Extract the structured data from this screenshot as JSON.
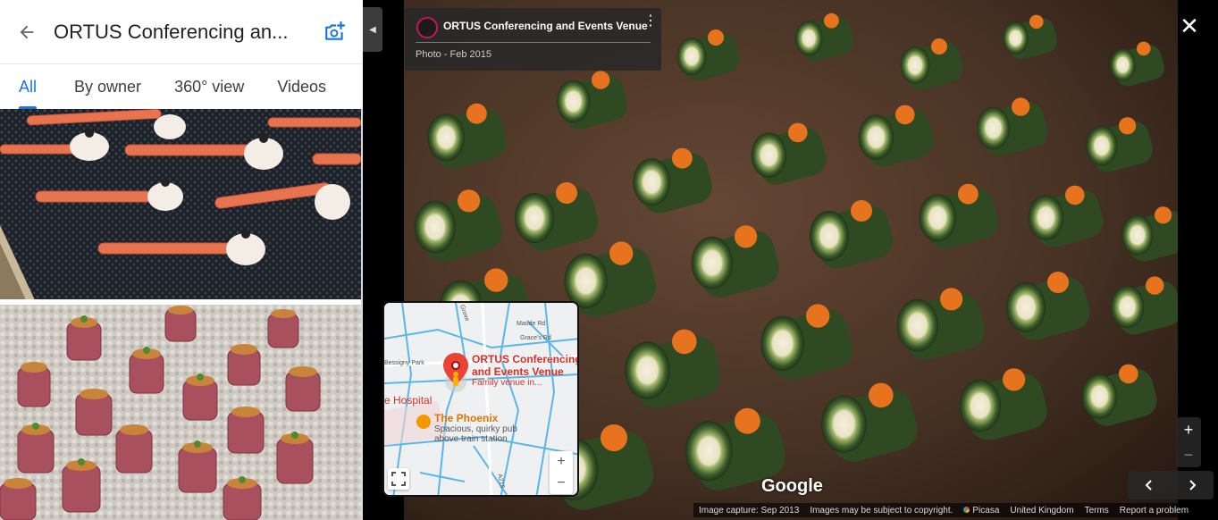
{
  "place": {
    "title": "ORTUS Conferencing an..."
  },
  "tabs": [
    {
      "label": "All",
      "active": true
    },
    {
      "label": "By owner",
      "active": false
    },
    {
      "label": "360° view",
      "active": false
    },
    {
      "label": "Videos",
      "active": false
    }
  ],
  "photo_info": {
    "title": "ORTUS Conferencing and Events Venue",
    "subtitle": "Photo - Feb 2015"
  },
  "minimap": {
    "place_name": "ORTUS Conferencing and Events Venue",
    "place_desc": "Family venue in...",
    "hospital": "e Hospital",
    "phoenix_name": "The Phoenix",
    "phoenix_desc": "Spacious, quirky pub above train station",
    "roads": [
      "Grove",
      "Maude Rd",
      "Grace's Rd",
      "Bessigny Park",
      "A215"
    ],
    "zoom_in": "+",
    "zoom_out": "−"
  },
  "controls": {
    "zoom_in": "+",
    "zoom_out": "−",
    "prev": "‹",
    "next": "›",
    "close": "✕"
  },
  "logo": "Google",
  "footer": {
    "capture": "Image capture: Sep 2013",
    "copyright": "Images may be subject to copyright.",
    "picasa": "Picasa",
    "region": "United Kingdom",
    "terms": "Terms",
    "report": "Report a problem"
  },
  "colors": {
    "accent": "#1a73e8",
    "map_pin": "#d93025"
  }
}
